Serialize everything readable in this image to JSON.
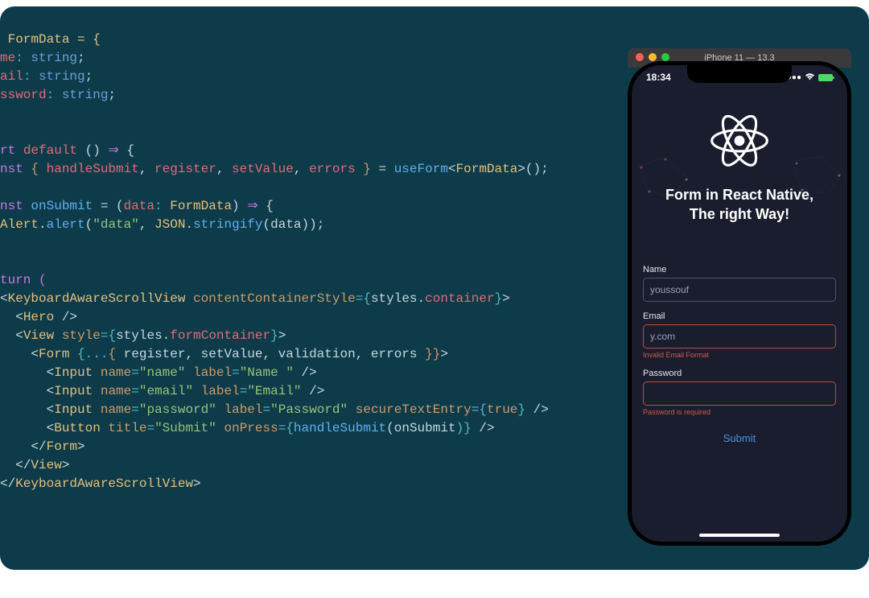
{
  "code": {
    "line1_type": " FormData = {",
    "line2a": "me",
    "line2b": ": ",
    "line2c": "string",
    "line2d": ";",
    "line3a": "ail",
    "line3b": ": ",
    "line3c": "string",
    "line3d": ";",
    "line4a": "ssword",
    "line4b": ": ",
    "line4c": "string",
    "line4d": ";",
    "line7a": "rt ",
    "line7b": "default",
    "line7c": " () ",
    "line7d": "⇒",
    "line7e": " {",
    "line8a": "nst ",
    "line8b": "{ ",
    "line8c": "handleSubmit",
    "line8d": ", ",
    "line8e": "register",
    "line8f": ", ",
    "line8g": "setValue",
    "line8h": ", ",
    "line8i": "errors",
    "line8j": " }",
    "line8k": " = ",
    "line8l": "useForm",
    "line8m": "<",
    "line8n": "FormData",
    "line8o": ">();",
    "line10a": "nst ",
    "line10b": "onSubmit",
    "line10c": " = (",
    "line10d": "data",
    "line10e": ": ",
    "line10f": "FormData",
    "line10g": ") ",
    "line10h": "⇒",
    "line10i": " {",
    "line11a": "Alert",
    "line11b": ".",
    "line11c": "alert",
    "line11d": "(",
    "line11e": "\"data\"",
    "line11f": ", ",
    "line11g": "JSON",
    "line11h": ".",
    "line11i": "stringify",
    "line11j": "(",
    "line11k": "data",
    "line11l": "));",
    "line14": "turn (",
    "line15a": "<",
    "line15b": "KeyboardAwareScrollView",
    "line15c": " ",
    "line15d": "contentContainerStyle",
    "line15e": "=",
    "line15f": "{",
    "line15g": "styles",
    "line15h": ".",
    "line15i": "container",
    "line15j": "}",
    "line15k": ">",
    "line16a": "  <",
    "line16b": "Hero",
    "line16c": " />",
    "line17a": "  <",
    "line17b": "View",
    "line17c": " ",
    "line17d": "style",
    "line17e": "=",
    "line17f": "{",
    "line17g": "styles",
    "line17h": ".",
    "line17i": "formContainer",
    "line17j": "}",
    "line17k": ">",
    "line18a": "    <",
    "line18b": "Form",
    "line18c": " {",
    "line18d": "...",
    "line18e": "{ ",
    "line18f": "register",
    "line18g": ", ",
    "line18h": "setValue",
    "line18i": ", ",
    "line18j": "validation",
    "line18k": ", ",
    "line18l": "errors",
    "line18m": " }}",
    "line18n": ">",
    "line19a": "      <",
    "line19b": "Input",
    "line19c": " ",
    "line19d": "name",
    "line19e": "=",
    "line19f": "\"name\"",
    "line19g": " ",
    "line19h": "label",
    "line19i": "=",
    "line19j": "\"Name \"",
    "line19k": " />",
    "line20a": "      <",
    "line20b": "Input",
    "line20c": " ",
    "line20d": "name",
    "line20e": "=",
    "line20f": "\"email\"",
    "line20g": " ",
    "line20h": "label",
    "line20i": "=",
    "line20j": "\"Email\"",
    "line20k": " />",
    "line21a": "      <",
    "line21b": "Input",
    "line21c": " ",
    "line21d": "name",
    "line21e": "=",
    "line21f": "\"password\"",
    "line21g": " ",
    "line21h": "label",
    "line21i": "=",
    "line21j": "\"Password\"",
    "line21k": " ",
    "line21l": "secureTextEntry",
    "line21m": "=",
    "line21n": "{",
    "line21o": "true",
    "line21p": "}",
    "line21q": " />",
    "line22a": "      <",
    "line22b": "Button",
    "line22c": " ",
    "line22d": "title",
    "line22e": "=",
    "line22f": "\"Submit\"",
    "line22g": " ",
    "line22h": "onPress",
    "line22i": "=",
    "line22j": "{",
    "line22k": "handleSubmit",
    "line22l": "(",
    "line22m": "onSubmit",
    "line22n": ")}",
    "line22o": " />",
    "line23a": "    </",
    "line23b": "Form",
    "line23c": ">",
    "line24a": "  </",
    "line24b": "View",
    "line24c": ">",
    "line25a": "</",
    "line25b": "KeyboardAwareScrollView",
    "line25c": ">"
  },
  "simulator": {
    "title": "iPhone 11 — 13.3",
    "time": "18:34"
  },
  "app": {
    "heading_line1": "Form in React Native,",
    "heading_line2": "The right Way!",
    "fields": {
      "name_label": "Name",
      "name_value": "youssouf",
      "email_label": "Email",
      "email_value": "y.com",
      "email_error": "Invalid Email Format",
      "password_label": "Password",
      "password_value": "",
      "password_error": "Password is required"
    },
    "submit_label": "Submit"
  }
}
